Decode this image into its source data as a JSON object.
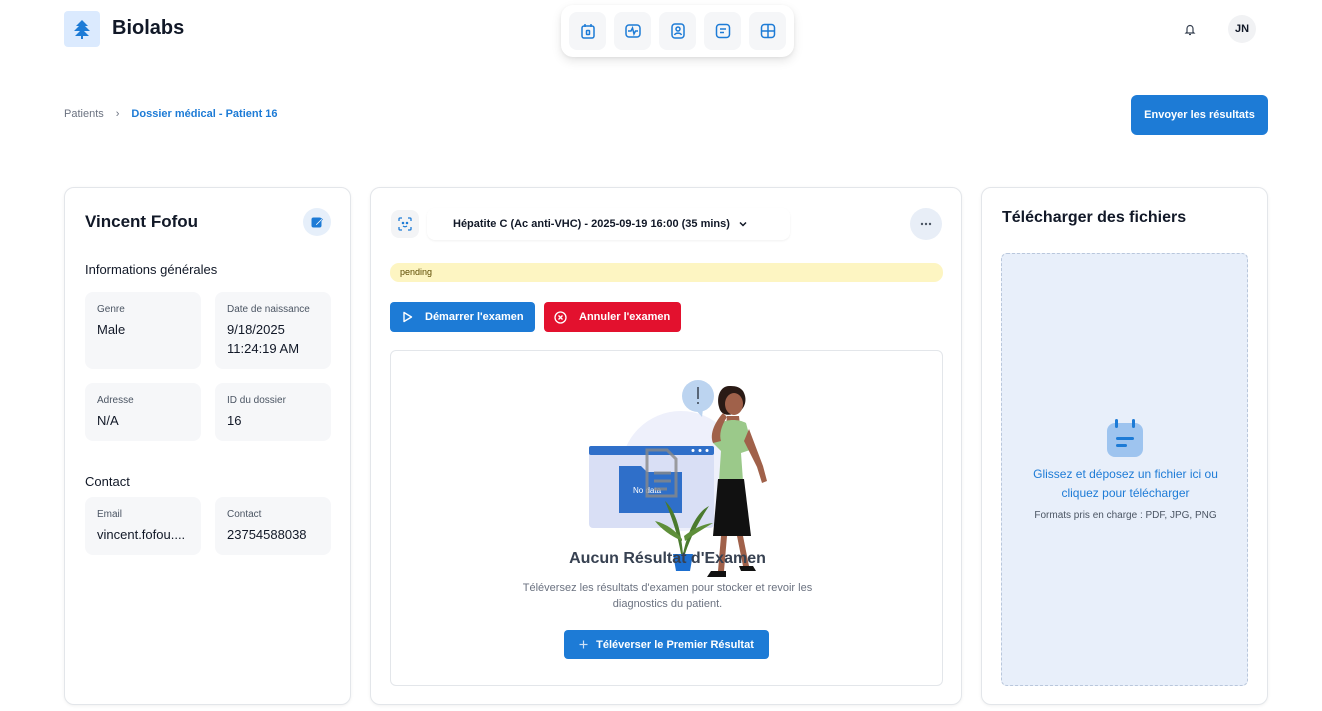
{
  "header": {
    "brand": "Biolabs",
    "nav_icons": [
      "calendar-icon",
      "activity-icon",
      "user-badge-icon",
      "message-icon",
      "dashboard-icon"
    ],
    "user_initials": "JN"
  },
  "breadcrumb": {
    "parent": "Patients",
    "separator": "›",
    "current": "Dossier médical - Patient 16"
  },
  "actions": {
    "send_results": "Envoyer les résultats"
  },
  "patient": {
    "name": "Vincent Fofou",
    "general_title": "Informations générales",
    "fields": [
      {
        "label": "Genre",
        "value": "Male"
      },
      {
        "label": "Date de naissance",
        "value": "9/18/2025 11:24:19 AM"
      },
      {
        "label": "Adresse",
        "value": "N/A"
      },
      {
        "label": "ID du dossier",
        "value": "16"
      }
    ],
    "contact_title": "Contact",
    "contact_fields": [
      {
        "label": "Email",
        "value": "vincent.fofou...."
      },
      {
        "label": "Contact",
        "value": "23754588038"
      }
    ]
  },
  "exam": {
    "selected": "Hépatite C (Ac anti-VHC) - 2025-09-19 16:00 (35 mins)",
    "status": "pending",
    "start_label": "Démarrer l'examen",
    "cancel_label": "Annuler l'examen",
    "empty_title": "Aucun Résultat d'Examen",
    "empty_desc": "Téléversez les résultats d'examen pour stocker et revoir les diagnostics du patient.",
    "no_data_label": "No data",
    "upload_first_label": "Téléverser le Premier Résultat"
  },
  "upload": {
    "title": "Télécharger des fichiers",
    "drop_text": "Glissez et déposez un fichier ici ou cliquez pour télécharger",
    "formats": "Formats pris en charge : PDF, JPG, PNG"
  },
  "colors": {
    "primary": "#1d7bd6",
    "danger": "#e3112e",
    "pending_bg": "#fdf5c2",
    "dropzone_bg": "#e8effa"
  }
}
